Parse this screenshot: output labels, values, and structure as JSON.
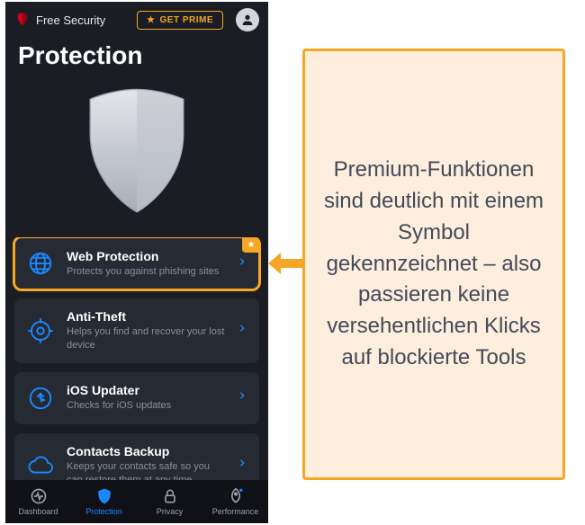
{
  "header": {
    "brand": "Free Security",
    "prime_label": "GET PRIME"
  },
  "page_title": "Protection",
  "cards": [
    {
      "id": "web-protection",
      "icon": "globe-icon",
      "title": "Web Protection",
      "subtitle": "Protects you against phishing sites",
      "premium": true,
      "highlighted": true
    },
    {
      "id": "anti-theft",
      "icon": "target-icon",
      "title": "Anti-Theft",
      "subtitle": "Helps you find and recover your lost device",
      "premium": false,
      "highlighted": false
    },
    {
      "id": "ios-updater",
      "icon": "update-icon",
      "title": "iOS Updater",
      "subtitle": "Checks for iOS updates",
      "premium": false,
      "highlighted": false
    },
    {
      "id": "contacts-backup",
      "icon": "cloud-icon",
      "title": "Contacts Backup",
      "subtitle": "Keeps your contacts safe so you can restore them at any time",
      "premium": false,
      "highlighted": false
    }
  ],
  "tabs": [
    {
      "id": "dashboard",
      "label": "Dashboard",
      "icon": "pulse-icon",
      "active": false
    },
    {
      "id": "protection",
      "label": "Protection",
      "icon": "shield-icon",
      "active": true
    },
    {
      "id": "privacy",
      "label": "Privacy",
      "icon": "lock-icon",
      "active": false
    },
    {
      "id": "performance",
      "label": "Performance",
      "icon": "rocket-icon",
      "active": false
    }
  ],
  "annotation": {
    "text": "Premium-Funktionen sind deutlich mit einem Symbol gekennzeichnet – also passieren keine versehentlichen Klicks auf blockierte Tools",
    "accent": "#f5a623",
    "bg": "#fdeedd"
  }
}
